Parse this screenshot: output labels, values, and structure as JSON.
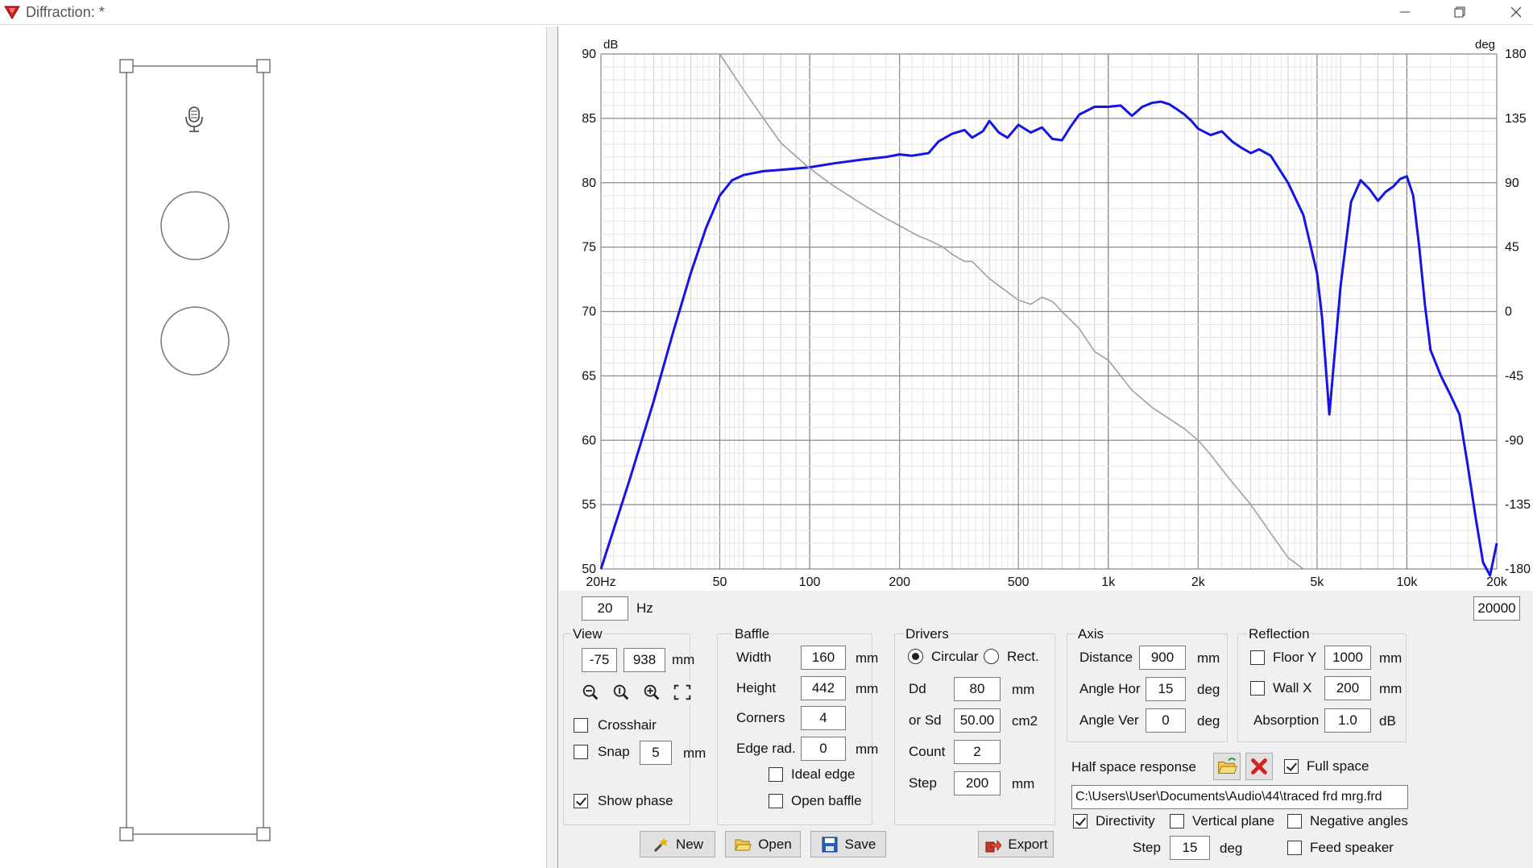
{
  "window": {
    "title": "Diffraction: *"
  },
  "graph": {
    "y_unit_left": "dB",
    "y_unit_right": "deg",
    "y_ticks_left": [
      "90",
      "85",
      "80",
      "75",
      "70",
      "65",
      "60",
      "55",
      "50"
    ],
    "y_ticks_right": [
      "180",
      "135",
      "90",
      "45",
      "0",
      "-45",
      "-90",
      "-135",
      "-180"
    ],
    "x_ticks": [
      "20Hz",
      "50",
      "100",
      "200",
      "500",
      "1k",
      "2k",
      "5k",
      "10k",
      "20k"
    ],
    "freq_min": "20",
    "freq_max": "20000",
    "freq_unit": "Hz"
  },
  "chart_data": {
    "type": "line",
    "x_scale": "log",
    "xlim": [
      20,
      20000
    ],
    "ylim": [
      50,
      90
    ],
    "y2lim": [
      -180,
      180
    ],
    "grid": true,
    "series": [
      {
        "color": "#1414e6",
        "axis": "left",
        "x": [
          20,
          25,
          30,
          35,
          40,
          45,
          50,
          55,
          60,
          70,
          80,
          100,
          120,
          150,
          180,
          200,
          220,
          250,
          270,
          300,
          330,
          350,
          380,
          400,
          430,
          460,
          500,
          550,
          600,
          650,
          700,
          750,
          800,
          900,
          1000,
          1100,
          1200,
          1300,
          1400,
          1500,
          1600,
          1700,
          1800,
          1900,
          2000,
          2200,
          2400,
          2600,
          2800,
          3000,
          3200,
          3500,
          4000,
          4500,
          5000,
          5200,
          5500,
          6000,
          6500,
          7000,
          7500,
          8000,
          8500,
          9000,
          9500,
          10000,
          10500,
          11000,
          11500,
          12000,
          13000,
          14000,
          15000,
          16000,
          17000,
          18000,
          19000,
          20000
        ],
        "y": [
          50,
          57,
          63,
          68.5,
          73,
          76.5,
          79,
          80.2,
          80.6,
          80.9,
          81,
          81.2,
          81.5,
          81.8,
          82,
          82.2,
          82.1,
          82.3,
          83.2,
          83.8,
          84.1,
          83.5,
          84.0,
          84.8,
          83.9,
          83.5,
          84.5,
          83.9,
          84.3,
          83.4,
          83.3,
          84.4,
          85.3,
          85.9,
          85.9,
          86.0,
          85.2,
          85.9,
          86.2,
          86.3,
          86.1,
          85.7,
          85.3,
          84.8,
          84.2,
          83.7,
          84.0,
          83.2,
          82.7,
          82.3,
          82.6,
          82.1,
          80.0,
          77.5,
          73.0,
          69.5,
          62.0,
          72.0,
          78.5,
          80.2,
          79.5,
          78.6,
          79.3,
          79.7,
          80.3,
          80.5,
          79.0,
          75.0,
          70.5,
          67.0,
          65.0,
          63.5,
          62.0,
          58.0,
          54.0,
          50.5,
          49.5,
          52.0
        ]
      },
      {
        "color": "#a0a0a0",
        "axis": "right",
        "x": [
          50,
          60,
          70,
          80,
          100,
          120,
          150,
          180,
          200,
          230,
          250,
          280,
          300,
          330,
          350,
          400,
          450,
          500,
          550,
          600,
          650,
          700,
          800,
          900,
          1000,
          1100,
          1200,
          1400,
          1600,
          1800,
          2000,
          2200,
          2500,
          3000,
          3500,
          4000,
          4500
        ],
        "y": [
          180,
          155,
          135,
          118,
          100,
          88,
          75,
          65,
          60,
          53,
          50,
          45,
          40,
          35,
          35,
          23,
          15,
          8,
          5,
          10,
          7,
          0,
          -12,
          -28,
          -34,
          -45,
          -55,
          -67,
          -75,
          -82,
          -90,
          -100,
          -115,
          -135,
          -155,
          -172,
          -180
        ]
      }
    ]
  },
  "view": {
    "title": "View",
    "x": "-75",
    "y": "938",
    "unit": "mm",
    "crosshair_label": "Crosshair",
    "snap_label": "Snap",
    "snap_value": "5",
    "snap_unit": "mm",
    "show_phase_label": "Show phase"
  },
  "baffle": {
    "title": "Baffle",
    "width_label": "Width",
    "width": "160",
    "height_label": "Height",
    "height": "442",
    "corners_label": "Corners",
    "corners": "4",
    "edge_label": "Edge rad.",
    "edge": "0",
    "unit": "mm",
    "ideal_edge_label": "Ideal edge",
    "open_baffle_label": "Open baffle"
  },
  "drivers": {
    "title": "Drivers",
    "circular_label": "Circular",
    "rect_label": "Rect.",
    "dd_label": "Dd",
    "dd": "80",
    "dd_unit": "mm",
    "sd_label": "or Sd",
    "sd": "50.00",
    "sd_unit": "cm2",
    "count_label": "Count",
    "count": "2",
    "step_label": "Step",
    "step": "200",
    "step_unit": "mm"
  },
  "axis": {
    "title": "Axis",
    "distance_label": "Distance",
    "distance": "900",
    "distance_unit": "mm",
    "angle_hor_label": "Angle Hor",
    "angle_hor": "15",
    "angle_ver_label": "Angle Ver",
    "angle_ver": "0",
    "unit": "deg"
  },
  "reflection": {
    "title": "Reflection",
    "floor_label": "Floor Y",
    "floor": "1000",
    "floor_unit": "mm",
    "wall_label": "Wall X",
    "wall": "200",
    "wall_unit": "mm",
    "absorption_label": "Absorption",
    "absorption": "1.0",
    "absorption_unit": "dB"
  },
  "half_space": {
    "label": "Half space response",
    "full_space_label": "Full space",
    "path": "C:\\Users\\User\\Documents\\Audio\\44\\traced frd mrg.frd"
  },
  "directivity": {
    "directivity_label": "Directivity",
    "vertical_plane_label": "Vertical plane",
    "negative_angles_label": "Negative angles",
    "step_label": "Step",
    "step": "15",
    "step_unit": "deg",
    "feed_speaker_label": "Feed speaker"
  },
  "buttons": {
    "new": "New",
    "open": "Open",
    "save": "Save",
    "export": "Export"
  },
  "colors": {
    "response": "#1414e6",
    "phase": "#a0a0a0",
    "grid": "#9a9a9a",
    "panel": "#f0f0f0"
  }
}
